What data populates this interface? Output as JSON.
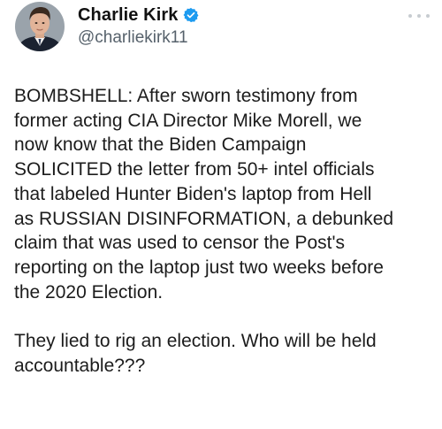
{
  "author": {
    "display_name": "Charlie Kirk",
    "handle": "@charliekirk11",
    "verified": true,
    "verified_color": "#1d9bf0"
  },
  "icons": {
    "avatar": "profile-photo",
    "verified": "verified-badge-icon",
    "more": "more-options-icon"
  },
  "tweet": {
    "paragraphs": [
      [
        "BOMBSHELL: After sworn testimony from",
        "former acting CIA Director Mike Morell, we",
        "now know that the Biden Campaign",
        "SOLICITED the letter from 50+ intel officials",
        "that labeled Hunter Biden's laptop from Hell",
        "as RUSSIAN DISINFORMATION, a debunked",
        "claim that was used to censor the Post's",
        "reporting on the laptop just two weeks before",
        "the 2020 Election."
      ],
      [
        "They lied to rig an election. Who will be held",
        "accountable???"
      ]
    ]
  }
}
